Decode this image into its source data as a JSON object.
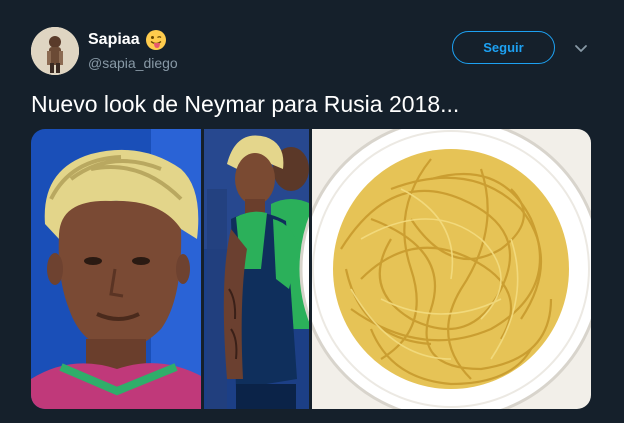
{
  "author": {
    "display_name": "Sapiaa",
    "emoji": "tongue-out-face-emoji",
    "handle": "@sapia_diego"
  },
  "follow_label": "Seguir",
  "tweet_text": "Nuevo look de Neymar para Rusia 2018...",
  "media": {
    "images": [
      "neymar-closeup-photo",
      "neymar-team-photo",
      "spaghetti-plate-photo"
    ]
  },
  "colors": {
    "background": "#15202b",
    "accent": "#1da1f2",
    "secondary_text": "#8899a6"
  }
}
